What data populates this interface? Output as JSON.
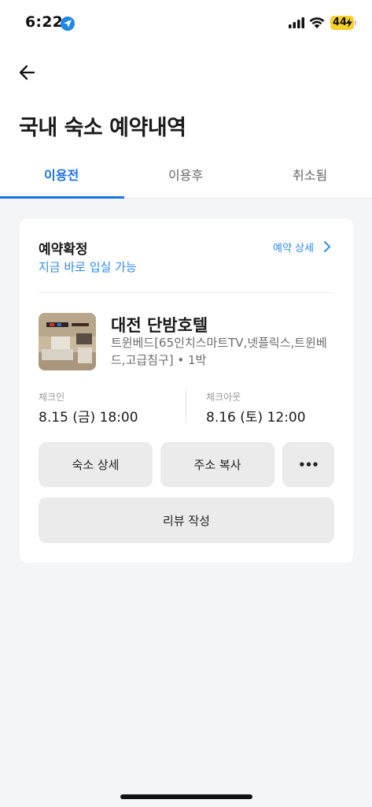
{
  "status_bar": {
    "time": "6:22",
    "battery": "44"
  },
  "header": {
    "title": "국내 숙소 예약내역"
  },
  "tabs": [
    {
      "label": "이용전",
      "active": true
    },
    {
      "label": "이용후",
      "active": false
    },
    {
      "label": "취소됨",
      "active": false
    }
  ],
  "reservation": {
    "status": "예약확정",
    "status_sub": "지금 바로 입실 가능",
    "detail_link": "예약 상세",
    "hotel_name": "대전 단밤호텔",
    "room_desc": "트윈베드[65인치스마트TV,넷플릭스,트윈베드,고급침구] • 1박",
    "checkin_label": "체크인",
    "checkin_value": "8.15 (금) 18:00",
    "checkout_label": "체크아웃",
    "checkout_value": "8.16 (토) 12:00",
    "buttons": {
      "lodging_detail": "숙소 상세",
      "copy_address": "주소 복사",
      "more": "•••",
      "write_review": "리뷰 작성"
    }
  },
  "colors": {
    "accent": "#1a73e8",
    "link": "#2f8cf0",
    "background": "#f4f5f7",
    "battery": "#f7d02a"
  }
}
